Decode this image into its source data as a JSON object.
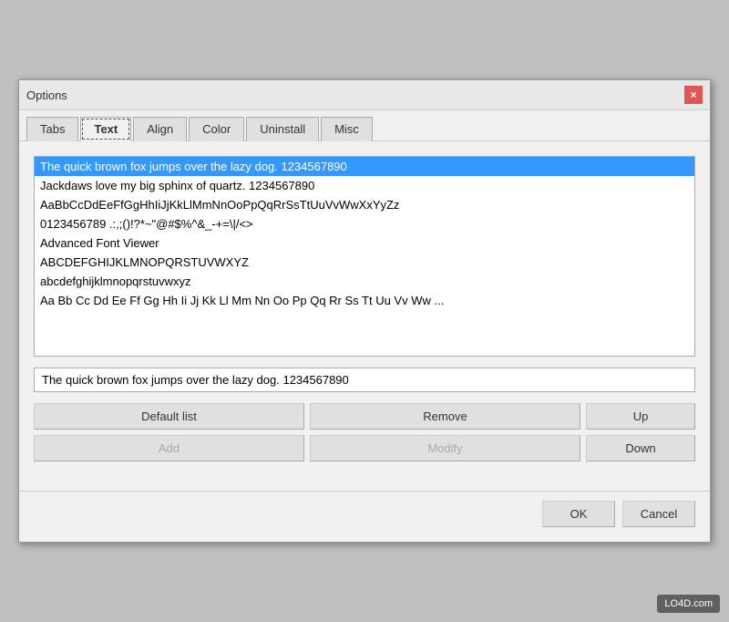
{
  "window": {
    "title": "Options",
    "close_label": "×"
  },
  "tabs": [
    {
      "label": "Tabs",
      "active": false
    },
    {
      "label": "Text",
      "active": true
    },
    {
      "label": "Align",
      "active": false
    },
    {
      "label": "Color",
      "active": false
    },
    {
      "label": "Uninstall",
      "active": false
    },
    {
      "label": "Misc",
      "active": false
    }
  ],
  "preview_items": [
    {
      "text": "The quick brown fox jumps over the lazy dog. 1234567890",
      "selected": true
    },
    {
      "text": "Jackdaws love my big sphinx of quartz. 1234567890",
      "selected": false
    },
    {
      "text": "AaBbCcDdEeFfGgHhIiJjKkLlMmNnOoPpQqRrSsTtUuVvWwXxYyZz",
      "selected": false
    },
    {
      "text": "0123456789 .:,;()!?*~\"@#$%^&_-+=\\|/<>",
      "selected": false
    },
    {
      "text": "Advanced Font Viewer",
      "selected": false
    },
    {
      "text": "ABCDEFGHIJKLMNOPQRSTUVWXYZ",
      "selected": false
    },
    {
      "text": "abcdefghijklmnopqrstuvwxyz",
      "selected": false
    },
    {
      "text": "Aa Bb Cc Dd Ee Ff Gg Hh Ii Jj Kk Ll Mm Nn Oo Pp Qq Rr Ss Tt Uu Vv Ww ...",
      "selected": false
    }
  ],
  "text_input": {
    "value": "The quick brown fox jumps over the lazy dog. 1234567890"
  },
  "buttons": {
    "default_list": "Default list",
    "remove": "Remove",
    "up": "Up",
    "add": "Add",
    "modify": "Modify",
    "down": "Down"
  },
  "footer": {
    "ok": "OK",
    "cancel": "Cancel"
  },
  "watermark": "LO4D.com"
}
